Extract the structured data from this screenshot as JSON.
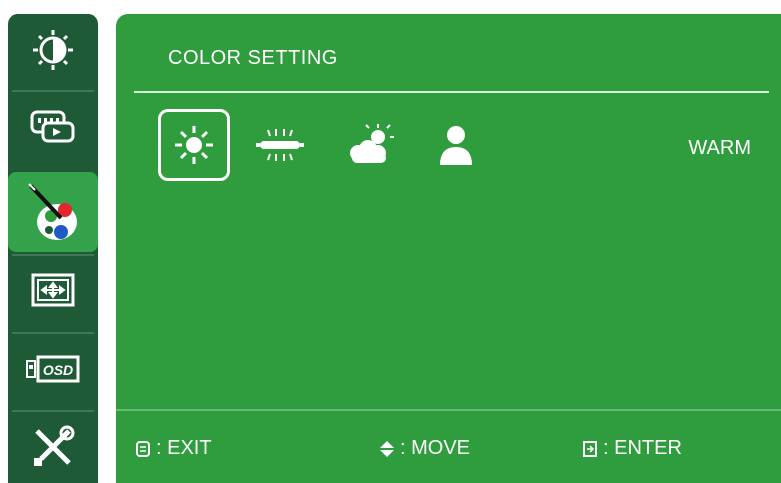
{
  "sidebar": {
    "items": [
      {
        "icon": "brightness-contrast-icon",
        "active": false
      },
      {
        "icon": "input-source-icon",
        "active": false
      },
      {
        "icon": "color-palette-icon",
        "active": true
      },
      {
        "icon": "image-position-icon",
        "active": false
      },
      {
        "icon": "osd-settings-icon",
        "active": false
      },
      {
        "icon": "tools-icon",
        "active": false
      }
    ]
  },
  "panel": {
    "title": "COLOR SETTING",
    "modes": [
      {
        "icon": "warm-sun-icon",
        "selected": true
      },
      {
        "icon": "cool-fluorescent-icon",
        "selected": false
      },
      {
        "icon": "natural-cloud-sun-icon",
        "selected": false
      },
      {
        "icon": "user-icon",
        "selected": false
      }
    ],
    "current_mode_label": "WARM"
  },
  "footer": {
    "exit_label": ": EXIT",
    "move_label": ": MOVE",
    "enter_label": ": ENTER"
  },
  "colors": {
    "panel_bg": "#2f9c3e",
    "sidebar_bg": "#1f5a37",
    "sidebar_active_bg": "#33a24a",
    "text": "#ffffff"
  }
}
